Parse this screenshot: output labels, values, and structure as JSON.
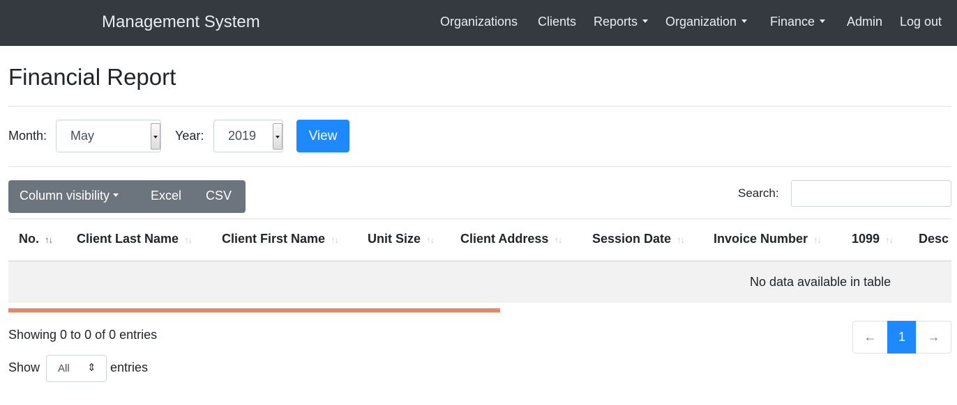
{
  "navbar": {
    "brand": "Management System",
    "items": [
      {
        "label": "Organizations"
      },
      {
        "label": "Clients"
      },
      {
        "label": "Reports",
        "dropdown": true
      },
      {
        "label": "Organization",
        "dropdown": true
      },
      {
        "label": "Finance",
        "dropdown": true
      },
      {
        "label": "Admin"
      },
      {
        "label": "Log out"
      }
    ]
  },
  "page": {
    "title": "Financial Report"
  },
  "filters": {
    "month_label": "Month:",
    "month_value": "May",
    "year_label": "Year:",
    "year_value": "2019",
    "view_button": "View"
  },
  "toolbar": {
    "column_visibility": "Column visibility",
    "excel": "Excel",
    "csv": "CSV",
    "search_label": "Search:",
    "search_value": ""
  },
  "table": {
    "columns": [
      "No.",
      "Client Last Name",
      "Client First Name",
      "Unit Size",
      "Client Address",
      "Session Date",
      "Invoice Number",
      "1099",
      "Desc"
    ],
    "sort_indicator": "↑↓",
    "empty_message": "No data available in table"
  },
  "footer": {
    "info": "Showing 0 to 0 of 0 entries",
    "length_prefix": "Show",
    "length_value": "All",
    "length_suffix": "entries",
    "pagination": {
      "prev": "←",
      "current": "1",
      "next": "→"
    }
  },
  "colors": {
    "navbar_bg": "#343a40",
    "primary": "#1e88ff",
    "secondary": "#6c757d",
    "progress": "#e8866a"
  }
}
